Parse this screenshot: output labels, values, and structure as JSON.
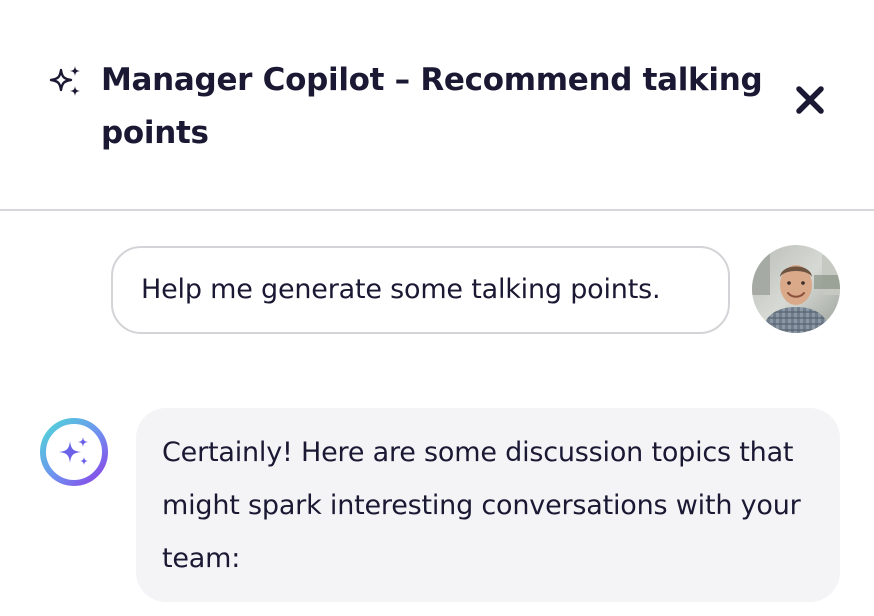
{
  "header": {
    "title": "Manager Copilot – Recommend talking points",
    "icon": "sparkles-icon",
    "close_icon": "close-icon"
  },
  "messages": {
    "user": {
      "text": "Help me generate some talking points.",
      "avatar": "user-avatar"
    },
    "assistant": {
      "text": "Certainly! Here are some discussion topics that might spark interesting conversations with your team:",
      "avatar": "copilot-sparkle-avatar"
    }
  },
  "colors": {
    "text": "#1a1833",
    "divider": "#d6d6dc",
    "user_bubble_border": "#d4d4d8",
    "assistant_bubble_bg": "#f4f4f6",
    "avatar_gradient_start": "#4fd1d9",
    "avatar_gradient_end": "#7c3aed",
    "sparkle_color": "#6366f1"
  }
}
